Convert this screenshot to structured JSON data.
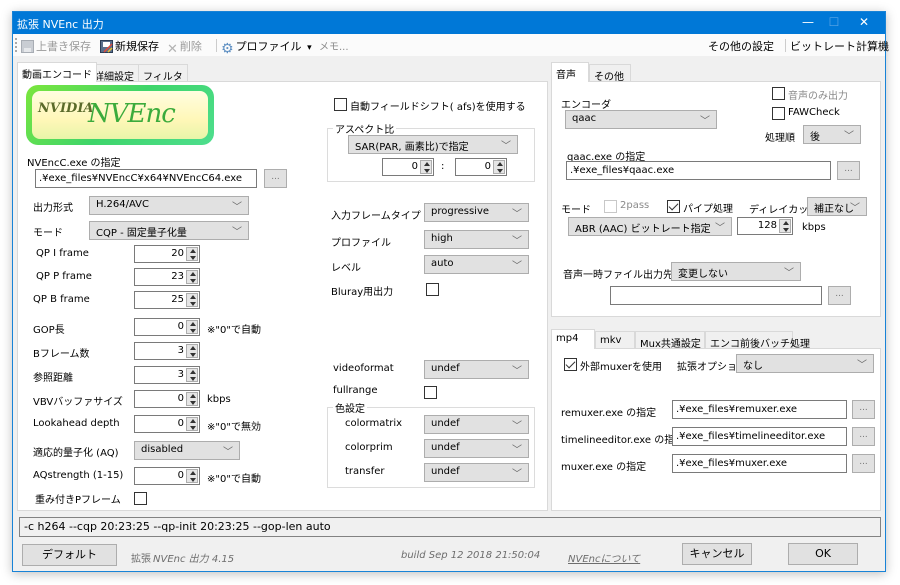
{
  "window": {
    "title": "拡張 NVEnc 出力",
    "controls": {
      "minimize": "—",
      "maximize": "☐",
      "close": "✕"
    }
  },
  "toolbar": {
    "overwrite_save": "上書き保存",
    "new_save": "新規保存",
    "delete": "削除",
    "profile": "プロファイル",
    "profile_arrow": "▾",
    "memo": "メモ...",
    "other_settings": "その他の設定",
    "bitrate_calc": "ビットレート計算機"
  },
  "left_tabs": [
    "動画エンコード",
    "詳細設定",
    "フィルタ"
  ],
  "video": {
    "logo_nvidia": "NVIDIA",
    "logo_nvenc": "NVEnc",
    "exe_label": "NVEncC.exe の指定",
    "exe_path": ".¥exe_files¥NVEncC¥x64¥NVEncC64.exe",
    "browse": "...",
    "output_format_label": "出力形式",
    "output_format": "H.264/AVC",
    "mode_label": "モード",
    "mode": "CQP - 固定量子化量",
    "qp_i_label": "QP I frame",
    "qp_i": "20",
    "qp_p_label": "QP P frame",
    "qp_p": "23",
    "qp_b_label": "QP B frame",
    "qp_b": "25",
    "gop_label": "GOP長",
    "gop": "0",
    "gop_note": "※\"0\"で自動",
    "bframes_label": "Bフレーム数",
    "bframes": "3",
    "ref_label": "参照距離",
    "ref": "3",
    "vbv_label": "VBVバッファサイズ",
    "vbv": "0",
    "vbv_unit": "kbps",
    "lookahead_label": "Lookahead depth",
    "lookahead": "0",
    "lookahead_note": "※\"0\"で無効",
    "aq_label": "適応的量子化 (AQ)",
    "aq": "disabled",
    "aqstrength_label": "AQstrength (1-15)",
    "aqstrength": "0",
    "aqstrength_note": "※\"0\"で自動",
    "weighted_p_label": "重み付きPフレーム",
    "weighted_p_checked": false,
    "afs_label": "自動フィールドシフト( afs)を使用する",
    "afs_checked": false,
    "aspect_group": "アスペクト比",
    "aspect_mode": "SAR(PAR, 画素比)で指定",
    "aspect_w": "0",
    "aspect_sep": ":",
    "aspect_h": "0",
    "input_frame_type_label": "入力フレームタイプ",
    "input_frame_type": "progressive",
    "profile_label": "プロファイル",
    "profile": "high",
    "level_label": "レベル",
    "level": "auto",
    "bluray_label": "Bluray用出力",
    "bluray_checked": false,
    "videoformat_label": "videoformat",
    "videoformat": "undef",
    "fullrange_label": "fullrange",
    "fullrange_checked": false,
    "color_group": "色設定",
    "colormatrix_label": "colormatrix",
    "colormatrix": "undef",
    "colorprim_label": "colorprim",
    "colorprim": "undef",
    "transfer_label": "transfer",
    "transfer": "undef"
  },
  "audio_tabs": [
    "音声",
    "その他"
  ],
  "audio": {
    "encoder_label": "エンコーダ",
    "encoder": "qaac",
    "audio_only_label": "音声のみ出力",
    "audio_only_checked": false,
    "fawcheck_label": "FAWCheck",
    "fawcheck_checked": false,
    "order_label": "処理順",
    "order": "後",
    "exe_label": "qaac.exe の指定",
    "exe_path": ".¥exe_files¥qaac.exe",
    "mode_label": "モード",
    "twopass_label": "2pass",
    "twopass_checked": false,
    "pipe_label": "パイプ処理",
    "pipe_checked": true,
    "delay_cut_label": "ディレイカット",
    "delay_cut": "補正なし",
    "mode": "ABR (AAC) ビットレート指定",
    "bitrate": "128",
    "bitrate_unit": "kbps",
    "temp_out_label": "音声一時ファイル出力先",
    "temp_out": "変更しない",
    "temp_path": ""
  },
  "mux_tabs": [
    "mp4",
    "mkv",
    "Mux共通設定",
    "エンコ前後バッチ処理"
  ],
  "mux": {
    "external_muxer_label": "外部muxerを使用",
    "external_muxer_checked": true,
    "ext_option_label": "拡張オプション",
    "ext_option": "なし",
    "remuxer_label": "remuxer.exe の指定",
    "remuxer_path": ".¥exe_files¥remuxer.exe",
    "timelineeditor_label": "timelineeditor.exe の指定",
    "timelineeditor_path": ".¥exe_files¥timelineeditor.exe",
    "muxer_label": "muxer.exe の指定",
    "muxer_path": ".¥exe_files¥muxer.exe"
  },
  "cmdline": "-c h264 --cqp 20:23:25 --qp-init 20:23:25 --gop-len auto",
  "footer": {
    "default_button": "デフォルト",
    "version_prefix": "拡張 ",
    "version": "NVEnc 出力 4.15",
    "build": "build Sep 12 2018 21:50:04",
    "about_link": "NVEncについて",
    "cancel_button": "キャンセル",
    "ok_button": "OK"
  }
}
